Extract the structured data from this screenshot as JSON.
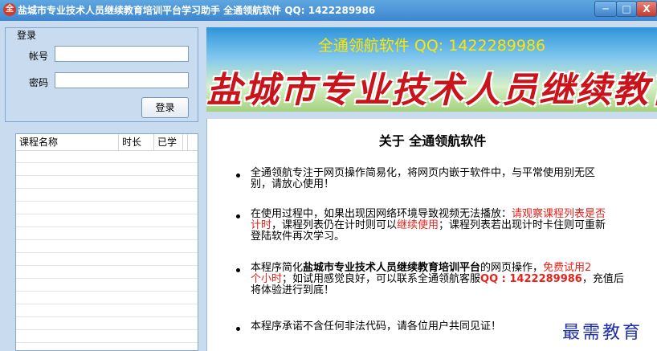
{
  "window": {
    "title": "盐城市专业技术人员继续教育培训平台学习助手 全通领航软件 QQ: 1422289986",
    "minimize": "─",
    "maximize": "□",
    "close": "X"
  },
  "login": {
    "legend": "登录",
    "account_label": "帐号",
    "account_value": "",
    "password_label": "密码",
    "password_value": "",
    "button": "登录"
  },
  "courses": {
    "columns": [
      "课程名称",
      "时长",
      "已学"
    ],
    "rows": []
  },
  "banner": {
    "contact": "全通领航软件 QQ: 1422289986",
    "title": "盐城市专业技术人员继续教育培训平台"
  },
  "about": {
    "title": "关于 全通领航软件",
    "p1": {
      "line1": "全通领航专注于网页操作简易化，将网页内嵌于软件中，与平常使用别无区",
      "line2": "别，请放心使用！"
    },
    "p2": {
      "l1_text": "在使用过程中，如果出现因网络环境导致视频无法播放：",
      "l1_red": "请观察课程列表是否",
      "l2_red1": "计时",
      "l2_text1": "，课程列表仍在计时则可以",
      "l2_red2": "继续使用",
      "l2_text2": "；课程列表若出现计时卡住则可重新",
      "l3_text": "登陆软件再次学习。"
    },
    "p3": {
      "l1_text1": "本程序简化",
      "l1_bold": "盐城市专业技术人员继续教育培训平台",
      "l1_text2": "的网页操作，",
      "l1_red": "免费试用2",
      "l2_red1": "个小时",
      "l2_text1": "；如试用感觉良好，可以联系全通领航客服",
      "l2_qq": "QQ : 1422289986",
      "l2_text2": "，充值后",
      "l3_text": "将体验进行到底！"
    },
    "p4": "本程序承诺不含任何非法代码，请各位用户共同见证！"
  },
  "watermark": "最需教育",
  "icons": {
    "app": "app-logo-icon"
  }
}
